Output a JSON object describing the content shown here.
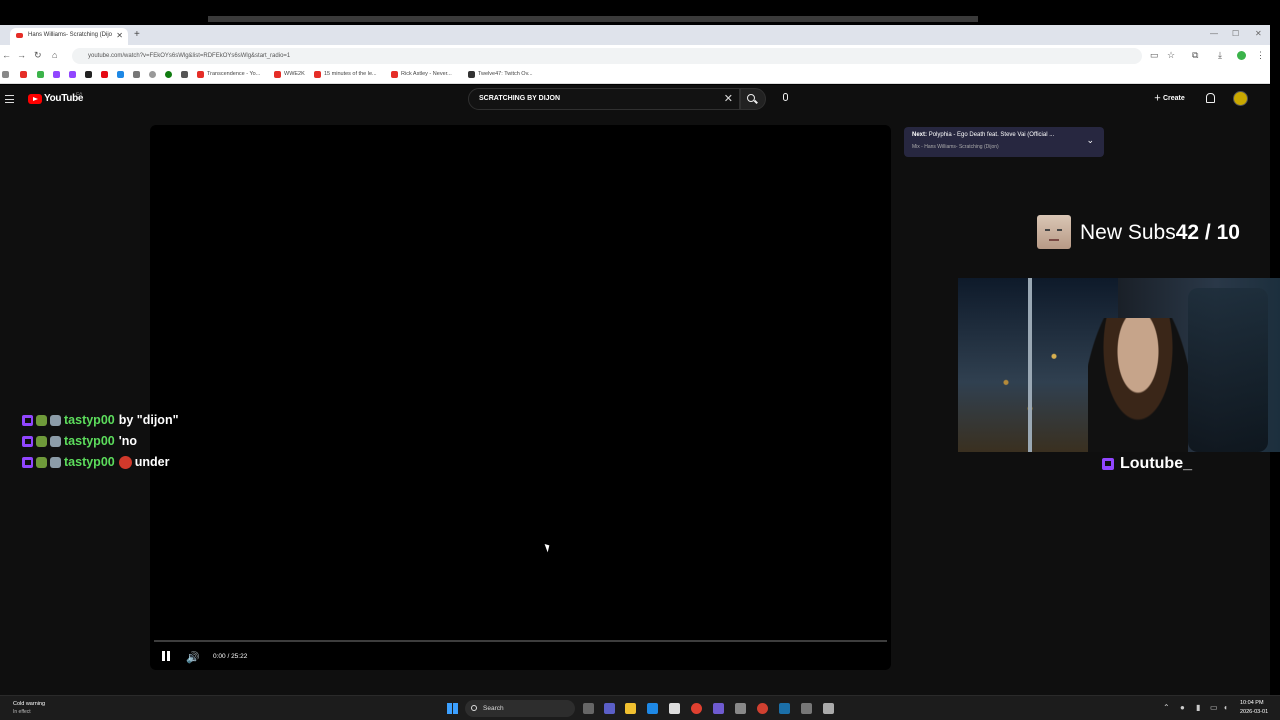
{
  "browser": {
    "tab_title": "Hans Williams- Scratching (Dijo",
    "url": "youtube.com/watch?v=FEkOYs6sWlg&list=RDFEkOYs6sWlg&start_radio=1",
    "bookmarks": [
      "Transcendence - Yo...",
      "WWE2K",
      "15 minutes of the le...",
      "Rick Astley - Never...",
      "Twelve47: Twitch Ov..."
    ]
  },
  "youtube": {
    "logo_text": "YouTube",
    "region": "CA",
    "search_value": "SCRATCHING BY DIJON",
    "create_label": "Create",
    "player": {
      "time": "0:00 / 25:22",
      "progress_fraction": 0.0
    },
    "up_next": {
      "prefix": "Next:",
      "title": "Polyphia - Ego Death feat. Steve Vai (Official ...",
      "subtitle": "Mix - Hans Williams- Scratching (Dijon)"
    }
  },
  "stream_overlay": {
    "subs_label": "New Subs",
    "subs_count": "42 / 10",
    "cam_name": "Loutube_",
    "chat": [
      {
        "user": "tastyp00",
        "message": "by \"dijon\"",
        "emote": false
      },
      {
        "user": "tastyp00",
        "message": "'no",
        "emote": false
      },
      {
        "user": "tastyp00",
        "message": "under",
        "emote": true
      }
    ]
  },
  "taskbar": {
    "weather_line1": "Cold warning",
    "weather_line2": "In effect",
    "search_label": "Search",
    "time": "10:04 PM",
    "date": "2026-03-01"
  },
  "colors": {
    "youtube_red": "#ff0000",
    "twitch_purple": "#9146ff",
    "chat_username": "#5cdc5c",
    "yt_bg": "#0f0f0f"
  }
}
